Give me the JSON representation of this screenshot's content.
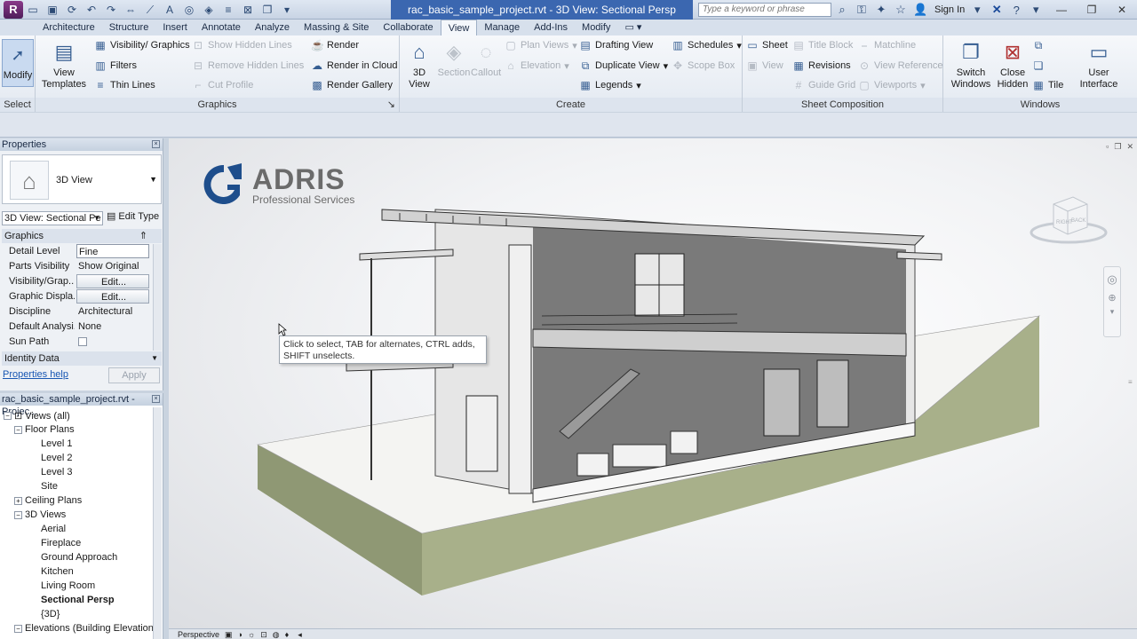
{
  "titlebar": {
    "app_logo": "R",
    "doc_title": "rac_basic_sample_project.rvt - 3D View: Sectional Persp",
    "search_placeholder": "Type a keyword or phrase",
    "sign_in": "Sign In"
  },
  "tabs": [
    "Architecture",
    "Structure",
    "Insert",
    "Annotate",
    "Analyze",
    "Massing & Site",
    "Collaborate",
    "View",
    "Manage",
    "Add-Ins",
    "Modify"
  ],
  "ribbon": {
    "select_panel": {
      "modify": "Modify",
      "title": "Select"
    },
    "graphics_panel": {
      "title": "Graphics",
      "view_templates": "View Templates",
      "visibility_graphics": "Visibility/ Graphics",
      "filters": "Filters",
      "thin_lines": "Thin Lines",
      "show_hidden_lines": "Show Hidden Lines",
      "remove_hidden_lines": "Remove Hidden Lines",
      "cut_profile": "Cut Profile",
      "render": "Render",
      "render_in_cloud": "Render in Cloud",
      "render_gallery": "Render Gallery"
    },
    "create_panel": {
      "title": "Create",
      "view_3d": "3D View",
      "section": "Section",
      "callout": "Callout",
      "plan_views": "Plan Views",
      "elevation": "Elevation",
      "drafting_view": "Drafting View",
      "duplicate_view": "Duplicate View",
      "legends": "Legends",
      "schedules": "Schedules",
      "scope_box": "Scope Box"
    },
    "sheet_panel": {
      "title": "Sheet Composition",
      "sheet": "Sheet",
      "view": "View",
      "title_block": "Title Block",
      "revisions": "Revisions",
      "guide_grid": "Guide Grid",
      "matchline": "Matchline",
      "view_reference": "View Reference",
      "viewports": "Viewports"
    },
    "windows_panel": {
      "title": "Windows",
      "switch_windows": "Switch Windows",
      "close_hidden": "Close Hidden",
      "tile": "Tile",
      "user_interface": "User Interface"
    }
  },
  "properties": {
    "title": "Properties",
    "type_name": "3D View",
    "view_select": "3D View: Sectional Pe",
    "edit_type": "Edit Type",
    "group_graphics": "Graphics",
    "rows": [
      {
        "key": "Detail Level",
        "value": "Fine"
      },
      {
        "key": "Parts Visibility",
        "value": "Show Original"
      },
      {
        "key": "Visibility/Grap...",
        "value": "Edit..."
      },
      {
        "key": "Graphic Displa...",
        "value": "Edit..."
      },
      {
        "key": "Discipline",
        "value": "Architectural"
      },
      {
        "key": "Default Analysi...",
        "value": "None"
      },
      {
        "key": "Sun Path",
        "value": ""
      }
    ],
    "group_identity": "Identity Data",
    "help": "Properties help",
    "apply": "Apply"
  },
  "browser": {
    "title": "rac_basic_sample_project.rvt - Projec...",
    "views_all": "Views (all)",
    "floor_plans": "Floor Plans",
    "levels": [
      "Level 1",
      "Level 2",
      "Level 3",
      "Site"
    ],
    "ceiling_plans": "Ceiling Plans",
    "views_3d": "3D Views",
    "views_3d_items": [
      "Aerial",
      "Fireplace",
      "Ground Approach",
      "Kitchen",
      "Living Room",
      "Sectional Persp",
      "{3D}"
    ],
    "elevations": "Elevations (Building Elevation"
  },
  "viewport": {
    "logo_name": "ADRIS",
    "logo_sub": "Professional Services",
    "tooltip": "Click to select, TAB for alternates, CTRL adds, SHIFT unselects.",
    "viewcube_right": "RIGHT",
    "viewcube_back": "BACK"
  },
  "statusbar": {
    "mode": "Perspective"
  },
  "colors": {
    "accent": "#3b67b0",
    "ground": "#a8b08a"
  }
}
